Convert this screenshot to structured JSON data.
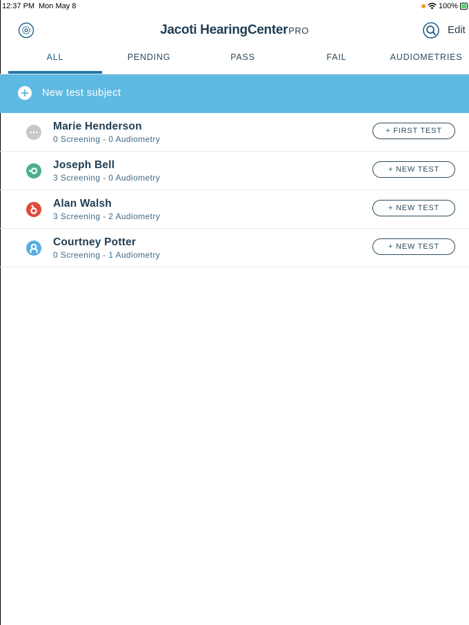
{
  "status_bar": {
    "time": "12:37 PM",
    "date": "Mon May 8",
    "battery": "100%",
    "icons": [
      "orange-dot-icon",
      "wifi-icon",
      "battery-charging-icon"
    ]
  },
  "header": {
    "title_brand": "Jacoti HearingCenter",
    "title_suffix": "PRO",
    "settings_icon": "gear-icon",
    "search_icon": "search-icon",
    "edit_label": "Edit"
  },
  "tabs": [
    {
      "label": "ALL",
      "active": true
    },
    {
      "label": "PENDING",
      "active": false
    },
    {
      "label": "PASS",
      "active": false
    },
    {
      "label": "FAIL",
      "active": false
    },
    {
      "label": "AUDIOMETRIES",
      "active": false
    }
  ],
  "new_subject": {
    "label": "New test subject",
    "icon": "plus-circle-icon"
  },
  "subjects": [
    {
      "name": "Marie Henderson",
      "summary": "0 Screening - 0 Audiometry",
      "status_icon": "pending-dots-icon",
      "status_color": "#c8c8c8",
      "button_label": "+ FIRST TEST"
    },
    {
      "name": "Joseph Bell",
      "summary": "3 Screening - 0 Audiometry",
      "status_icon": "pass-ear-icon",
      "status_color": "#4caf8f",
      "button_label": "+ NEW TEST"
    },
    {
      "name": "Alan Walsh",
      "summary": "3 Screening - 2 Audiometry",
      "status_icon": "fail-ear-icon",
      "status_color": "#e04a3c",
      "button_label": "+ NEW TEST"
    },
    {
      "name": "Courtney Potter",
      "summary": "0 Screening - 1 Audiometry",
      "status_icon": "audiometry-icon",
      "status_color": "#5aaee0",
      "button_label": "+ NEW TEST"
    }
  ],
  "colors": {
    "accent": "#1f78a8",
    "banner": "#5fbae3",
    "text_dark": "#1f3d52"
  }
}
